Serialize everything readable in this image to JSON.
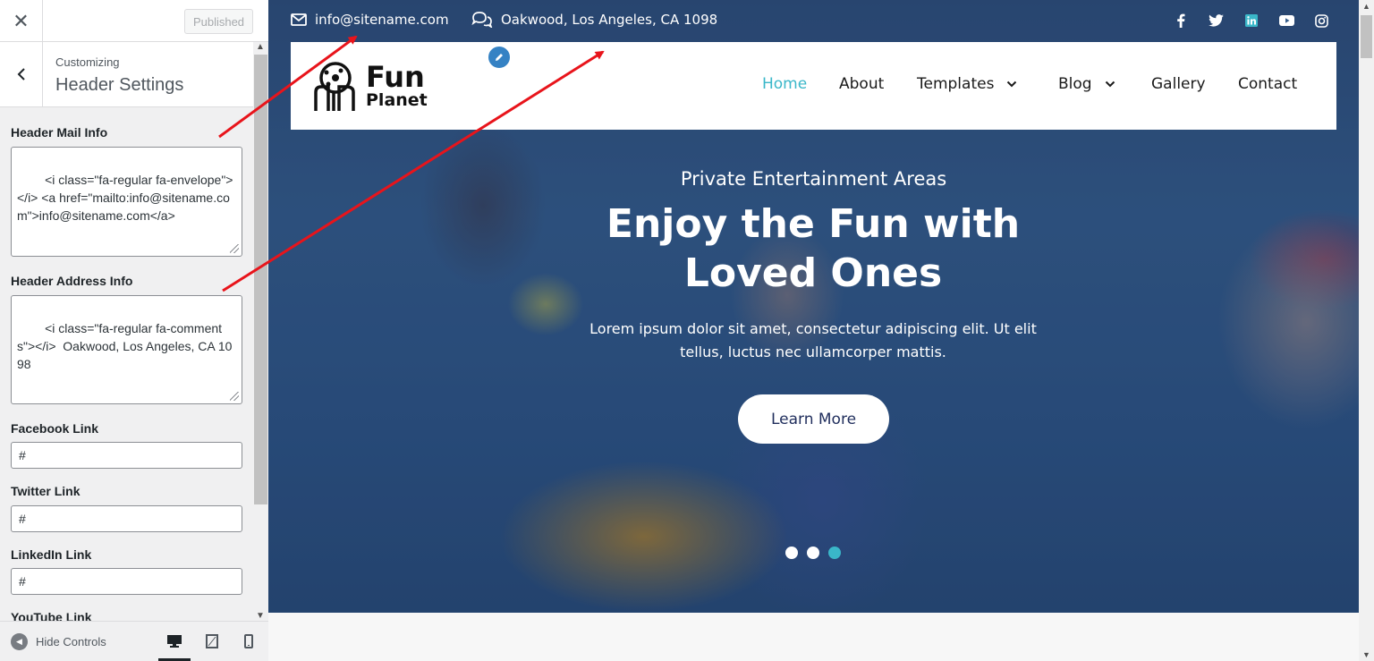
{
  "sidebar": {
    "publish_label": "Published",
    "breadcrumb": "Customizing",
    "section_title": "Header Settings",
    "controls": {
      "mail": {
        "label": "Header Mail Info",
        "value": "<i class=\"fa-regular fa-envelope\"></i> <a href=\"mailto:info@sitename.com\">info@sitename.com</a>"
      },
      "address": {
        "label": "Header Address Info",
        "value": "<i class=\"fa-regular fa-comments\"></i>  Oakwood, Los Angeles, CA 1098"
      },
      "facebook": {
        "label": "Facebook Link",
        "value": "#"
      },
      "twitter": {
        "label": "Twitter Link",
        "value": "#"
      },
      "linkedin": {
        "label": "LinkedIn Link",
        "value": "#"
      },
      "youtube": {
        "label": "YouTube Link"
      }
    },
    "hide_controls_label": "Hide Controls"
  },
  "site": {
    "topbar": {
      "email": "info@sitename.com",
      "address": "Oakwood, Los Angeles, CA 1098",
      "social_icons": [
        "facebook-icon",
        "twitter-icon",
        "linkedin-icon",
        "youtube-icon",
        "instagram-icon"
      ]
    },
    "logo": {
      "line1": "Fun",
      "line2": "Planet"
    },
    "nav": [
      "Home",
      "About",
      "Templates",
      "Blog",
      "Gallery",
      "Contact"
    ],
    "hero": {
      "subtitle": "Private Entertainment Areas",
      "title": "Enjoy the Fun with Loved Ones",
      "text": "Lorem ipsum dolor sit amet, consectetur adipiscing elit. Ut elit tellus, luctus nec ullamcorper mattis.",
      "button": "Learn More",
      "slides": 3,
      "active_slide": 3
    }
  },
  "colors": {
    "accent": "#3ab7c9",
    "annotation_arrow": "#e8141b",
    "wp_blue": "#3582c4"
  }
}
